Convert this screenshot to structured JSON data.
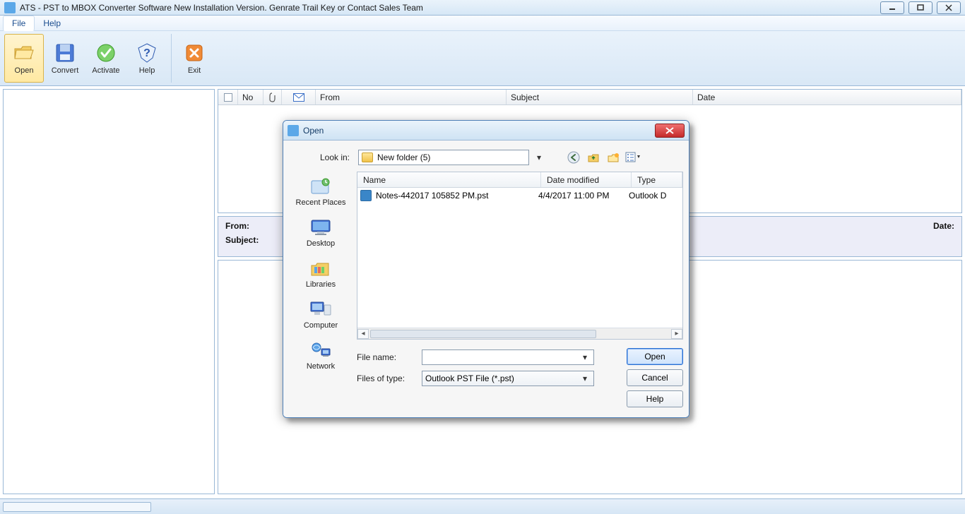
{
  "window": {
    "title": "ATS - PST to MBOX Converter Software New Installation Version. Genrate Trail Key or Contact Sales Team"
  },
  "menubar": {
    "file": "File",
    "help": "Help"
  },
  "toolbar": {
    "open": "Open",
    "convert": "Convert",
    "activate": "Activate",
    "help": "Help",
    "exit": "Exit"
  },
  "grid": {
    "no": "No",
    "from": "From",
    "subject": "Subject",
    "date": "Date"
  },
  "meta": {
    "from_label": "From:",
    "date_label": "Date:",
    "subject_label": "Subject:"
  },
  "dialog": {
    "title": "Open",
    "lookin_label": "Look in:",
    "lookin_value": "New folder (5)",
    "places": {
      "recent": "Recent Places",
      "desktop": "Desktop",
      "libraries": "Libraries",
      "computer": "Computer",
      "network": "Network"
    },
    "columns": {
      "name": "Name",
      "modified": "Date modified",
      "type": "Type"
    },
    "rows": [
      {
        "name": "Notes-442017 105852 PM.pst",
        "modified": "4/4/2017 11:00 PM",
        "type": "Outlook D"
      }
    ],
    "filename_label": "File name:",
    "filename_value": "",
    "filetype_label": "Files of type:",
    "filetype_value": "Outlook PST File (*.pst)",
    "open_btn": "Open",
    "cancel_btn": "Cancel",
    "help_btn": "Help"
  }
}
